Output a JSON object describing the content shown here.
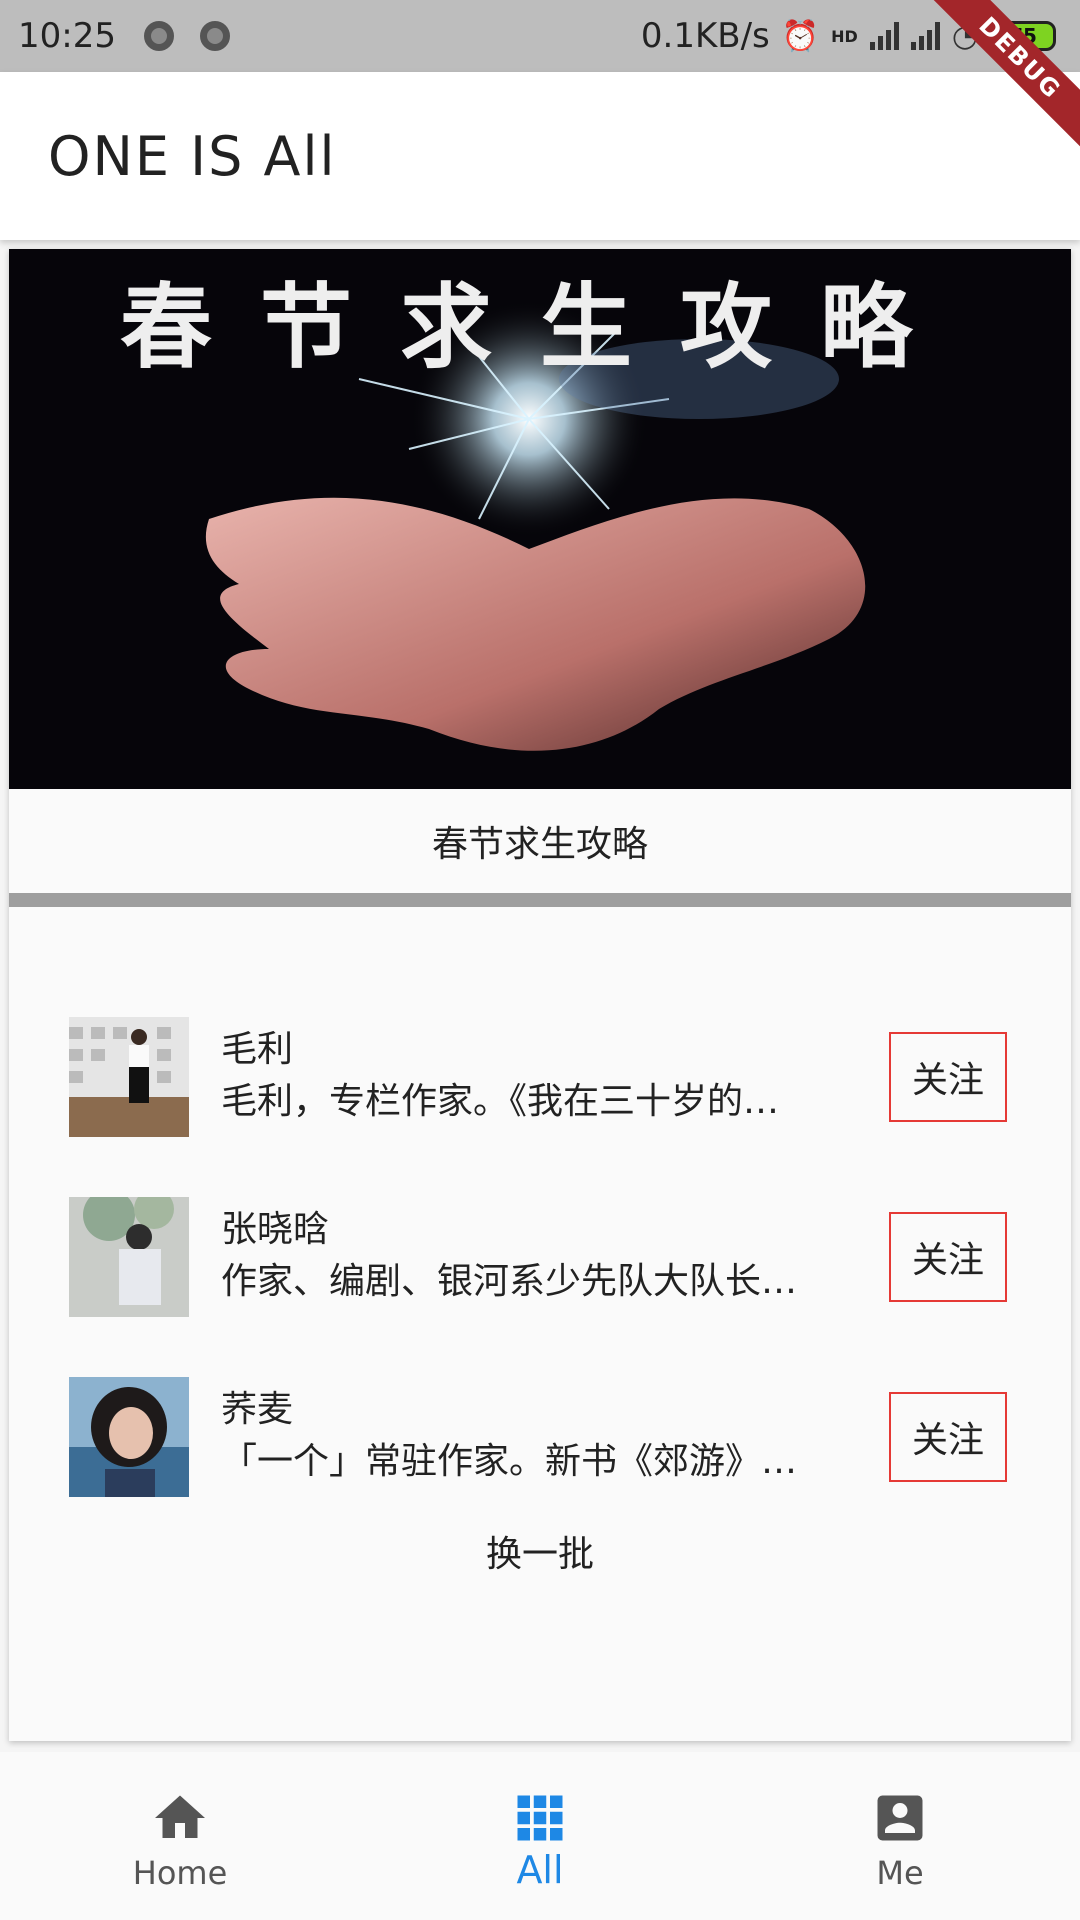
{
  "status_bar": {
    "time": "10:25",
    "network_speed": "0.1KB/s",
    "hd_label": "HD",
    "battery": "75"
  },
  "debug_ribbon": "DEBUG",
  "app_bar": {
    "title": "ONE  IS  All"
  },
  "banner": {
    "headline": "春节求生攻略",
    "caption": "春节求生攻略"
  },
  "authors": [
    {
      "name": "毛利",
      "desc": "毛利，专栏作家。《我在三十岁的…",
      "follow_label": "关注"
    },
    {
      "name": "张晓晗",
      "desc": "作家、编剧、银河系少先队大队长…",
      "follow_label": "关注"
    },
    {
      "name": "荞麦",
      "desc": "「一个」常驻作家。新书《郊游》…",
      "follow_label": "关注"
    }
  ],
  "refresh_label": "换一批",
  "bottom_nav": {
    "items": [
      {
        "label": "Home",
        "icon": "home-icon"
      },
      {
        "label": "All",
        "icon": "grid-icon"
      },
      {
        "label": "Me",
        "icon": "account-box-icon"
      }
    ],
    "active_index": 1
  },
  "colors": {
    "accent": "#1e88e5",
    "follow_border": "#e53935",
    "status_bar": "#bdbdbd",
    "battery": "#7ed321",
    "debug_ribbon": "#a3262a"
  }
}
